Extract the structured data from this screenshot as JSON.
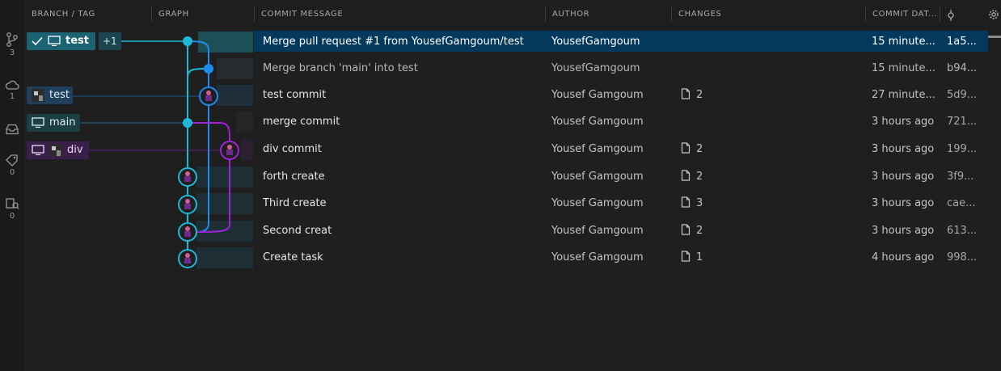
{
  "sidebar": {
    "items": [
      {
        "icon": "source-control-icon",
        "count": "3"
      },
      {
        "icon": "cloud-icon",
        "count": "1"
      },
      {
        "icon": "inbox-icon",
        "count": ""
      },
      {
        "icon": "tag-icon",
        "count": "0"
      },
      {
        "icon": "worktree-icon",
        "count": "0"
      }
    ]
  },
  "header": {
    "branch_tag": "BRANCH / TAG",
    "graph": "GRAPH",
    "commit_message": "COMMIT MESSAGE",
    "author": "AUTHOR",
    "changes": "CHANGES",
    "commit_date": "COMMIT DAT..."
  },
  "colors": {
    "accent": "#1fb8d6",
    "blue": "#1d8cf0",
    "purple": "#a221d8",
    "selected": "#04395e"
  },
  "branches": {
    "test_head": {
      "label": "test",
      "plus": "+1"
    },
    "test_remote": {
      "label": "test"
    },
    "main": {
      "label": "main"
    },
    "div": {
      "label": "div"
    }
  },
  "commits": [
    {
      "message": "Merge pull request #1 from YousefGamgoum/test",
      "author": "YousefGamgoum",
      "changes": "",
      "date": "15 minute...",
      "sha": "1a5..."
    },
    {
      "message": "Merge branch 'main' into test",
      "author": "YousefGamgoum",
      "changes": "",
      "date": "15 minute...",
      "sha": "b94..."
    },
    {
      "message": "test commit",
      "author": "Yousef Gamgoum",
      "changes": "2",
      "date": "27 minute...",
      "sha": "5d9..."
    },
    {
      "message": "merge commit",
      "author": "Yousef Gamgoum",
      "changes": "",
      "date": "3 hours ago",
      "sha": "721..."
    },
    {
      "message": "div commit",
      "author": "Yousef Gamgoum",
      "changes": "2",
      "date": "3 hours ago",
      "sha": "199..."
    },
    {
      "message": "forth create",
      "author": "Yousef Gamgoum",
      "changes": "2",
      "date": "3 hours ago",
      "sha": "3f9..."
    },
    {
      "message": "Third create",
      "author": "Yousef Gamgoum",
      "changes": "3",
      "date": "3 hours ago",
      "sha": "cae..."
    },
    {
      "message": "Second creat",
      "author": "Yousef Gamgoum",
      "changes": "2",
      "date": "3 hours ago",
      "sha": "613..."
    },
    {
      "message": "Create task",
      "author": "Yousef Gamgoum",
      "changes": "1",
      "date": "4 hours ago",
      "sha": "998..."
    }
  ]
}
